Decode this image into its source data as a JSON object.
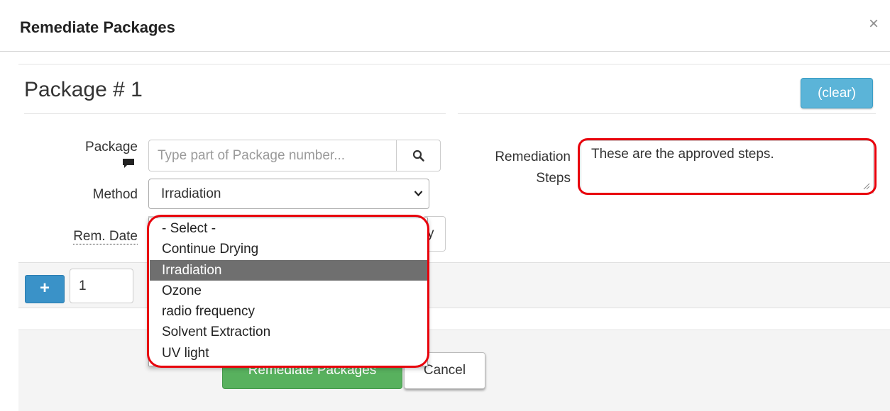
{
  "modal": {
    "title": "Remediate Packages",
    "close_glyph": "×"
  },
  "package": {
    "heading": "Package # 1",
    "clear_label": "(clear)",
    "package_label": "Package",
    "package_placeholder": "Type part of Package number...",
    "method_label": "Method",
    "method_value": "Irradiation",
    "remdate_label": "Rem. Date",
    "remdate_button_stub": "y",
    "steps_label": "Remediation Steps",
    "steps_value": "These are the approved steps."
  },
  "method_options": [
    {
      "label": "- Select -",
      "selected": false
    },
    {
      "label": "Continue Drying",
      "selected": false
    },
    {
      "label": "Irradiation",
      "selected": true
    },
    {
      "label": "Ozone",
      "selected": false
    },
    {
      "label": "radio frequency",
      "selected": false
    },
    {
      "label": "Solvent Extraction",
      "selected": false
    },
    {
      "label": "UV light",
      "selected": false
    }
  ],
  "add_bar": {
    "add_label": "+",
    "count_value": "1"
  },
  "footer": {
    "submit_label": "Remediate Packages",
    "cancel_label": "Cancel"
  },
  "colors": {
    "info_button": "#5bb4d8",
    "primary_button": "#3a92c8",
    "success_button": "#58b15e",
    "highlight": "#e8000b",
    "selected_option": "#6f6f6f"
  },
  "icons": {
    "comment": "comment-icon",
    "search": "search-icon",
    "chevron": "chevron-down-icon",
    "close": "close-icon"
  }
}
